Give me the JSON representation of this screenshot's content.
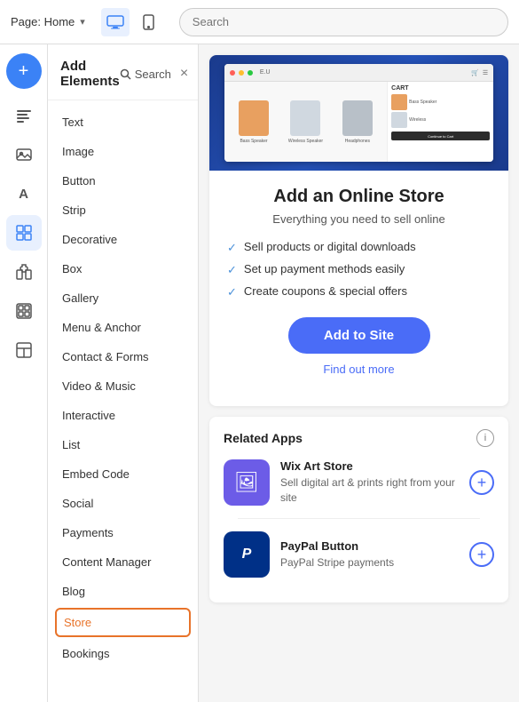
{
  "topbar": {
    "page_label": "Page: Home",
    "search_placeholder": "Search"
  },
  "icon_sidebar": {
    "add_icon": "+",
    "text_icon": "≡",
    "image_icon": "▤",
    "font_icon": "A",
    "grid_icon": "⊞",
    "puzzle_icon": "⋮",
    "photo_icon": "▦",
    "table_icon": "⊟"
  },
  "elements_panel": {
    "title": "Add Elements",
    "search_label": "Search",
    "close_label": "×",
    "items": [
      {
        "label": "Text",
        "selected": false
      },
      {
        "label": "Image",
        "selected": false
      },
      {
        "label": "Button",
        "selected": false
      },
      {
        "label": "Strip",
        "selected": false
      },
      {
        "label": "Decorative",
        "selected": false
      },
      {
        "label": "Box",
        "selected": false
      },
      {
        "label": "Gallery",
        "selected": false
      },
      {
        "label": "Menu & Anchor",
        "selected": false
      },
      {
        "label": "Contact & Forms",
        "selected": false
      },
      {
        "label": "Video & Music",
        "selected": false
      },
      {
        "label": "Interactive",
        "selected": false
      },
      {
        "label": "List",
        "selected": false
      },
      {
        "label": "Embed Code",
        "selected": false
      },
      {
        "label": "Social",
        "selected": false
      },
      {
        "label": "Payments",
        "selected": false
      },
      {
        "label": "Content Manager",
        "selected": false
      },
      {
        "label": "Blog",
        "selected": false
      },
      {
        "label": "Store",
        "selected": true
      },
      {
        "label": "Bookings",
        "selected": false
      }
    ]
  },
  "store_detail": {
    "title": "Add an Online Store",
    "tagline": "Everything you need to sell online",
    "features": [
      "Sell products or digital downloads",
      "Set up payment methods easily",
      "Create coupons & special offers"
    ],
    "add_button": "Add to Site",
    "find_more": "Find out more",
    "brand_label": "E.U",
    "products": [
      {
        "label": "Bass Speaker",
        "color": "#e8a060"
      },
      {
        "label": "Wireless Speaker",
        "color": "#c0c0c0"
      },
      {
        "label": "Headphones",
        "color": "#e0e0e0"
      }
    ],
    "cart_title": "CART",
    "cart_button": "Continue to Cart"
  },
  "related_apps": {
    "title": "Related Apps",
    "apps": [
      {
        "name": "Wix Art Store",
        "description": "Sell digital art & prints right from your site",
        "icon_symbol": "🖼",
        "icon_style": "wix-art"
      },
      {
        "name": "PayPal Button",
        "description": "PayPal Stripe payments",
        "icon_symbol": "P",
        "icon_style": "paypal"
      }
    ]
  }
}
